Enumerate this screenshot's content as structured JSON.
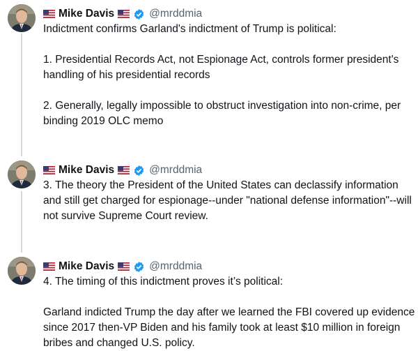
{
  "tweets": [
    {
      "author": {
        "name": "Mike Davis",
        "handle": "@mrddmia",
        "name_flag_left": "us-flag-icon",
        "name_flag_right": "us-flag-icon",
        "verified_icon": "verified-badge-icon"
      },
      "paragraphs": [
        "Indictment confirms Garland's indictment of Trump is political:",
        "1. Presidential Records Act, not Espionage Act, controls former president's handling of his presidential records",
        "2. Generally, legally impossible to obstruct investigation into non-crime, per binding 2019 OLC memo"
      ]
    },
    {
      "author": {
        "name": "Mike Davis",
        "handle": "@mrddmia",
        "name_flag_left": "us-flag-icon",
        "name_flag_right": "us-flag-icon",
        "verified_icon": "verified-badge-icon"
      },
      "paragraphs": [
        "3. The theory the President of the United States can declassify information and still get charged for espionage--under \"national defense information\"--will not survive Supreme Court review."
      ]
    },
    {
      "author": {
        "name": "Mike Davis",
        "handle": "@mrddmia",
        "name_flag_left": "us-flag-icon",
        "name_flag_right": "us-flag-icon",
        "verified_icon": "verified-badge-icon"
      },
      "paragraphs": [
        "4. The timing of this indictment proves it’s political:",
        "Garland indicted Trump the day after we learned the FBI covered up evidence since 2017 then-VP Biden and his family took at least $10 million in foreign bribes and changed U.S. policy."
      ]
    }
  ],
  "colors": {
    "text": "#0f1419",
    "handle": "#536471",
    "verified": "#1d9bf0",
    "thread_line": "#cfd9de"
  }
}
